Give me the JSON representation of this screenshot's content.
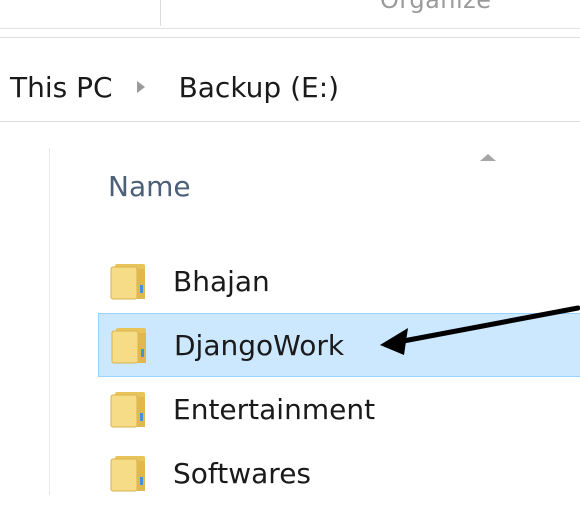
{
  "ribbon": {
    "label": "Organize"
  },
  "breadcrumb": {
    "items": [
      "This PC",
      "Backup (E:)"
    ]
  },
  "columns": {
    "name": "Name",
    "sort_direction": "ascending"
  },
  "files": [
    {
      "label": "Bhajan",
      "icon": "folder-icon",
      "selected": false
    },
    {
      "label": "DjangoWork",
      "icon": "folder-icon",
      "selected": true
    },
    {
      "label": "Entertainment",
      "icon": "folder-icon",
      "selected": false
    },
    {
      "label": "Softwares",
      "icon": "folder-icon",
      "selected": false
    }
  ],
  "colors": {
    "selection_fill": "#cce8ff",
    "selection_border": "#99d1ff",
    "header_text": "#4c607a",
    "folder_yellow": "#f3d36b",
    "annotation_arrow": "#000000"
  }
}
